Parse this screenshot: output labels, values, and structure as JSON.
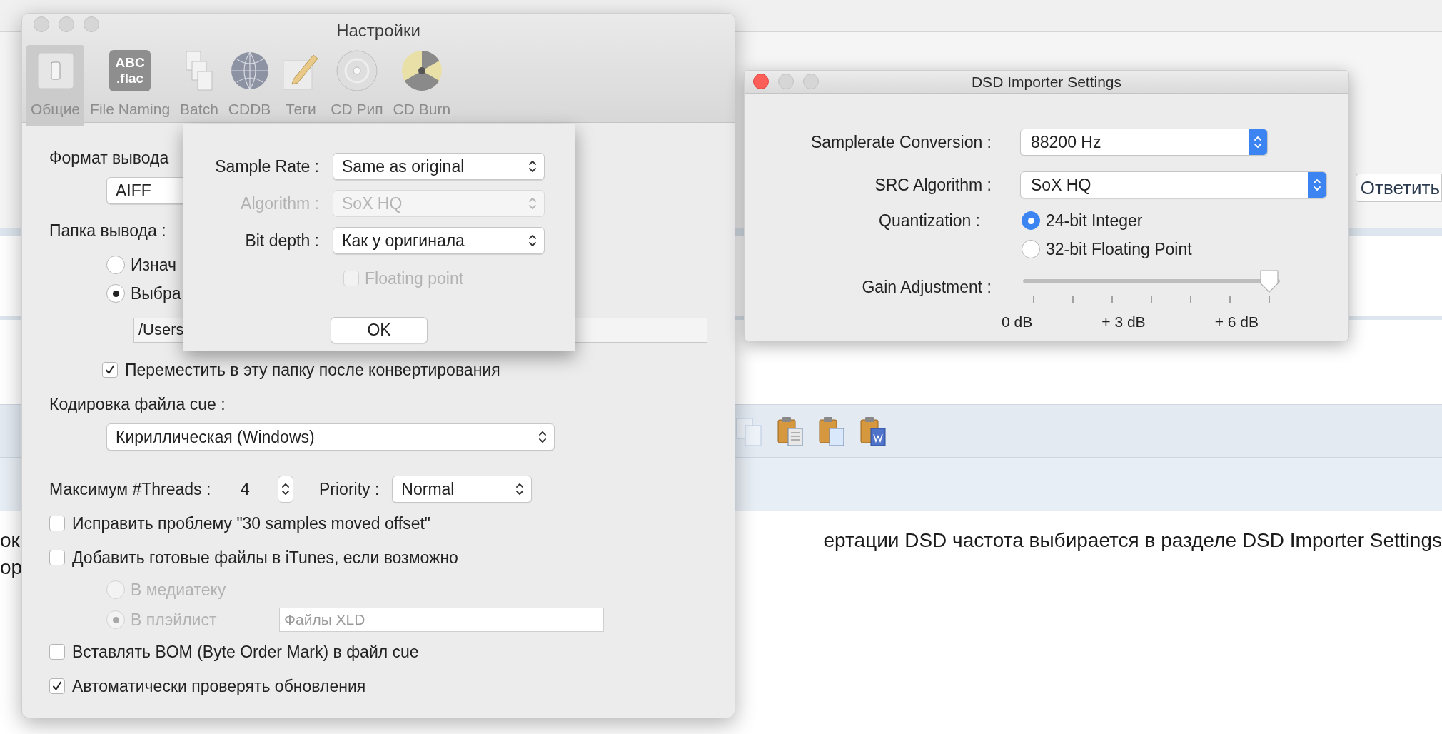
{
  "background": {
    "reply_button": "Ответить",
    "article_lines": [
      {
        "left": "ок",
        "right": "ертации DSD частота выбирается в разделе DSD Importer Settings"
      },
      {
        "left": "ор"
      }
    ]
  },
  "settings_window": {
    "title": "Настройки",
    "tabs": [
      {
        "label": "Общие",
        "selected": true,
        "kind": "switch"
      },
      {
        "label": "File Naming",
        "selected": false,
        "kind": "badge",
        "icon_text": [
          "ABC",
          ".flac"
        ]
      },
      {
        "label": "Batch",
        "selected": false,
        "kind": "pages"
      },
      {
        "label": "CDDB",
        "selected": false,
        "kind": "globe"
      },
      {
        "label": "Теги",
        "selected": false,
        "kind": "pencil"
      },
      {
        "label": "CD Рип",
        "selected": false,
        "kind": "disc"
      },
      {
        "label": "CD Burn",
        "selected": false,
        "kind": "burn"
      }
    ],
    "output_format": {
      "label": "Формат вывода",
      "value": "AIFF"
    },
    "output_folder": {
      "label": "Папка вывода :",
      "options": [
        {
          "label": "Изнач",
          "selected": false
        },
        {
          "label": "Выбра",
          "selected": true
        }
      ],
      "path": "/Users",
      "move": {
        "label": "Переместить в эту папку после конвертирования",
        "checked": true
      }
    },
    "cue_encoding": {
      "label": "Кодировка файла cue :",
      "value": "Кириллическая (Windows)"
    },
    "threads": {
      "label": "Максимум #Threads :",
      "value": "4"
    },
    "priority": {
      "label": "Priority :",
      "value": "Normal"
    },
    "options": [
      {
        "kind": "checkbox",
        "label": "Исправить проблему \"30 samples moved offset\"",
        "checked": false,
        "disabled": false
      },
      {
        "kind": "checkbox",
        "label": "Добавить готовые файлы в iTunes, если возможно",
        "checked": false,
        "disabled": false
      },
      {
        "kind": "radio",
        "label": "В медиатеку",
        "selected": false,
        "disabled": true
      },
      {
        "kind": "radio",
        "label": "В плэйлист",
        "selected": true,
        "disabled": true,
        "field": "Файлы XLD"
      },
      {
        "kind": "checkbox",
        "label": "Вставлять BOM (Byte Order Mark) в файл cue",
        "checked": false,
        "disabled": false
      },
      {
        "kind": "checkbox",
        "label": "Автоматически проверять обновления",
        "checked": true,
        "disabled": false
      }
    ]
  },
  "sheet": {
    "rows": [
      {
        "label": "Sample Rate :",
        "value": "Same as original",
        "disabled": false
      },
      {
        "label": "Algorithm :",
        "value": "SoX HQ",
        "disabled": true
      },
      {
        "label": "Bit depth :",
        "value": "Как у оригинала",
        "disabled": false
      }
    ],
    "floating_point": {
      "label": "Floating point",
      "checked": false,
      "disabled": true
    },
    "ok": "OK"
  },
  "dsd_window": {
    "title": "DSD Importer Settings",
    "samplerate": {
      "label": "Samplerate Conversion :",
      "value": "88200 Hz"
    },
    "algorithm": {
      "label": "SRC Algorithm :",
      "value": "SoX HQ"
    },
    "quantization": {
      "label": "Quantization :",
      "options": [
        {
          "label": "24-bit Integer",
          "selected": true
        },
        {
          "label": "32-bit Floating Point",
          "selected": false
        }
      ]
    },
    "gain": {
      "label": "Gain Adjustment :",
      "level": 1,
      "tick_labels": [
        "0 dB",
        "+ 3 dB",
        "+ 6 dB"
      ]
    }
  }
}
